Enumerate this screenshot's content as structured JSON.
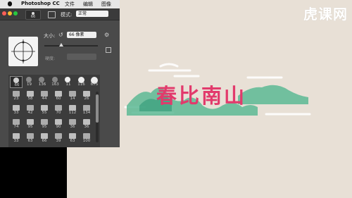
{
  "menubar": {
    "app_name": "Photoshop CC",
    "items": [
      "文件",
      "编辑",
      "图像"
    ]
  },
  "options_bar": {
    "brush_size_value": "66",
    "mode_label": "模式:",
    "mode_value": "正常"
  },
  "brush_panel": {
    "size_label": "大小:",
    "size_value": "66 像素",
    "hardness_label": "硬度:",
    "presets": [
      "66",
      "19",
      "136",
      "163",
      "11",
      "116",
      "675",
      "23",
      "58",
      "44",
      "60",
      "14",
      "26",
      "33",
      "42",
      "55",
      "70",
      "112",
      "134",
      "74",
      "95",
      "95",
      "90",
      "36",
      "36",
      "33",
      "63",
      "66",
      "39",
      "63",
      "100"
    ]
  },
  "canvas": {
    "title": "春比南山",
    "watermark": "虎课网"
  },
  "colors": {
    "title_pink": "#e23a6c",
    "mountain_green": "#5cb894",
    "canvas_bg": "#e8e0d6",
    "panel_bg": "#4a4a4a"
  }
}
